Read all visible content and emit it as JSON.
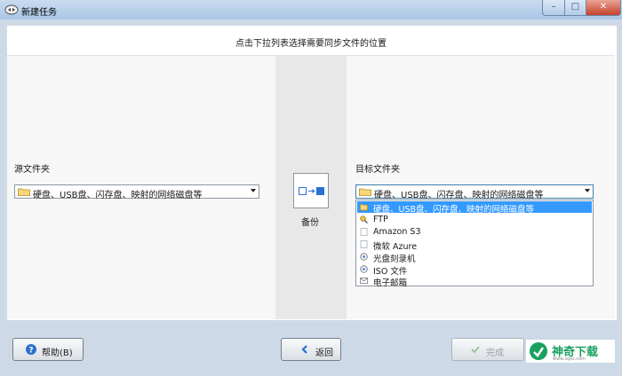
{
  "window": {
    "title": "新建任务",
    "minimize_glyph": "–",
    "maximize_glyph": "□",
    "close_glyph": "✕"
  },
  "header": {
    "instruction": "点击下拉列表选择需要同步文件的位置"
  },
  "source": {
    "label": "源文件夹",
    "selected": "硬盘、USB盘、闪存盘、映射的网络磁盘等"
  },
  "sync": {
    "mode_label": "备份"
  },
  "target": {
    "label": "目标文件夹",
    "selected": "硬盘、USB盘、闪存盘、映射的网络磁盘等",
    "options": [
      {
        "label": "硬盘、USB盘、闪存盘、映射的网络磁盘等",
        "icon": "folder-icon",
        "selected": true
      },
      {
        "label": "FTP",
        "icon": "ftp-icon",
        "selected": false
      },
      {
        "label": "Amazon S3",
        "icon": "cloud-icon",
        "selected": false
      },
      {
        "label": "微软 Azure",
        "icon": "cloud-icon",
        "selected": false
      },
      {
        "label": "光盘刻录机",
        "icon": "disc-icon",
        "selected": false
      },
      {
        "label": "ISO 文件",
        "icon": "disc-icon",
        "selected": false
      },
      {
        "label": "电子邮箱",
        "icon": "mail-icon",
        "selected": false
      }
    ]
  },
  "buttons": {
    "help": "帮助(B)",
    "back": "返回",
    "finish": "完成"
  },
  "watermark": {
    "text": "神奇下载",
    "sub": "www.sqxz.com"
  },
  "colors": {
    "selection": "#3399ff",
    "titlebar": "#b9d1ea",
    "accent": "#2b6fd1"
  }
}
